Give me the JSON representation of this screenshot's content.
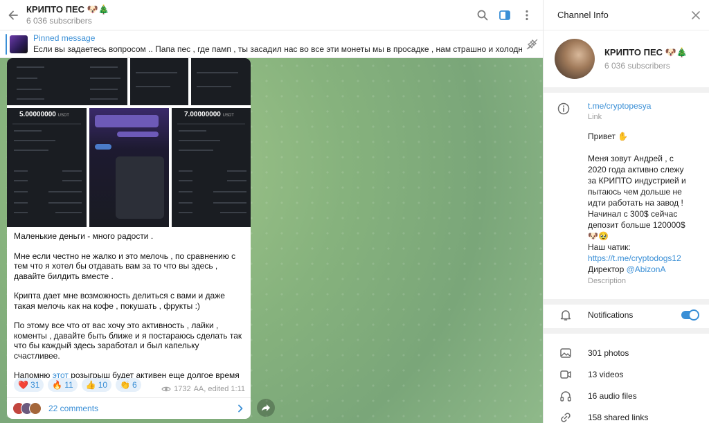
{
  "header": {
    "title": "КРИПТО ПЕС 🐶🎄",
    "subtitle": "6 036 subscribers"
  },
  "pinned": {
    "title": "Pinned message",
    "text": "Если вы задаетесь вопросом ..   Папа пес , где памп , ты засадил нас во все эти монеты мы в просадке , нам страшно и холодно , мы ..."
  },
  "photos": {
    "amount_1": "5.00000000",
    "amount_2": "7.00000000",
    "unit": "USDT"
  },
  "message": {
    "paragraphs": [
      "Маленькие деньги - много радости .",
      "Мне если честно не жалко и это мелочь , по сравнению с тем что я хотел бы отдавать вам за то что вы здесь , давайте билдить вместе .",
      "Крипта дает мне возможность делиться с вами и даже такая мелочь как на кофе , покушать , фрукты :)",
      "По этому все что от вас хочу это активность , лайки , коменты , давайте быть ближе и я постараюсь сделать так что бы каждый здесь заработал и был капельку счастливее."
    ],
    "last_prefix": "Напомню ",
    "last_link": "этот",
    "last_suffix": " розыгрыш будет активен еще долгое время ",
    "last_emoji": "❤️"
  },
  "reactions": [
    {
      "emoji": "❤️",
      "count": "31"
    },
    {
      "emoji": "🔥",
      "count": "11"
    },
    {
      "emoji": "👍",
      "count": "10"
    },
    {
      "emoji": "👏",
      "count": "6"
    }
  ],
  "meta": {
    "views": "1732",
    "author_edit": "AA, edited 1:11"
  },
  "comments": {
    "label": "22 comments"
  },
  "info": {
    "title": "Channel Info",
    "name": "КРИПТО ПЕС 🐶🎄",
    "subscribers": "6 036 subscribers",
    "link": "t.me/cryptopesya",
    "link_label": "Link",
    "desc": {
      "greeting": "Привет ✋",
      "body": "Меня зовут Андрей , с 2020 года активно слежу за КРИПТО индустрией и пытаюсь чем дольше не идти работать на завод ! Начинал с 300$ сейчас депозит больше 120000$ 🐶🥹",
      "chat_label": "Наш чатик:",
      "chat_link": "https://t.me/cryptodogs12",
      "director_label": "Директор ",
      "director_link": "@AbizonA"
    },
    "desc_label": "Description",
    "notifications": "Notifications",
    "media": [
      {
        "icon": "photo-icon",
        "label": "301 photos"
      },
      {
        "icon": "video-icon",
        "label": "13 videos"
      },
      {
        "icon": "headphones-icon",
        "label": "16 audio files"
      },
      {
        "icon": "link-icon",
        "label": "158 shared links"
      }
    ]
  },
  "colors": {
    "accent": "#3a8fd6",
    "chat_bg": "#86b27d",
    "heart": "#e0253a"
  }
}
